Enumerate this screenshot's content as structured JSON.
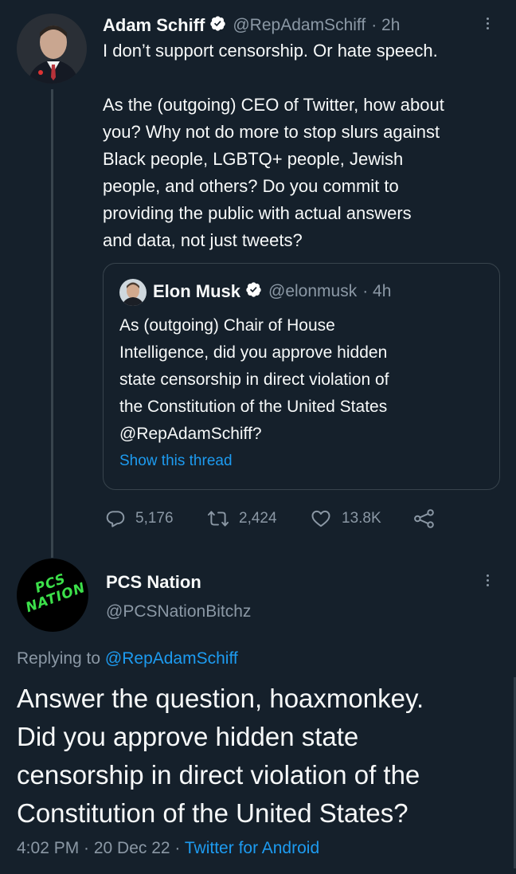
{
  "tweet": {
    "author": "Adam Schiff",
    "handle": "@RepAdamSchiff",
    "time": "· 2h",
    "text": "I don’t support censorship. Or hate speech.\n\nAs the (outgoing) CEO of Twitter, how about\nyou? Why not do more to stop slurs against\nBlack people, LGBTQ+ people, Jewish\npeople, and others? Do you commit to\nproviding the public with actual answers\nand data, not just tweets?",
    "quote": {
      "author": "Elon Musk",
      "handle": "@elonmusk",
      "time": "· 4h",
      "text": "As (outgoing) Chair of House\nIntelligence, did you approve hidden\nstate censorship in direct violation of\nthe Constitution of the United States\n@RepAdamSchiff?",
      "show_thread": "Show this thread"
    },
    "stats": {
      "replies": "5,176",
      "retweets": "2,424",
      "likes": "13.8K"
    }
  },
  "reply": {
    "author": "PCS Nation",
    "handle": "@PCSNationBitchz",
    "avatar_text": "PCS\nNATION",
    "replying_prefix": "Replying to ",
    "replying_handle": "@RepAdamSchiff",
    "text": "Answer the question, hoaxmonkey.\nDid you approve hidden state\ncensorship in direct violation of the\nConstitution of the United States?",
    "timestamp": "4:02 PM · 20 Dec 22 · ",
    "source": "Twitter for Android"
  },
  "colors": {
    "background": "#15202b",
    "accent": "#1d9bf0",
    "muted": "#8b98a5",
    "border": "#38444d",
    "logo_green": "#3ce04a"
  }
}
